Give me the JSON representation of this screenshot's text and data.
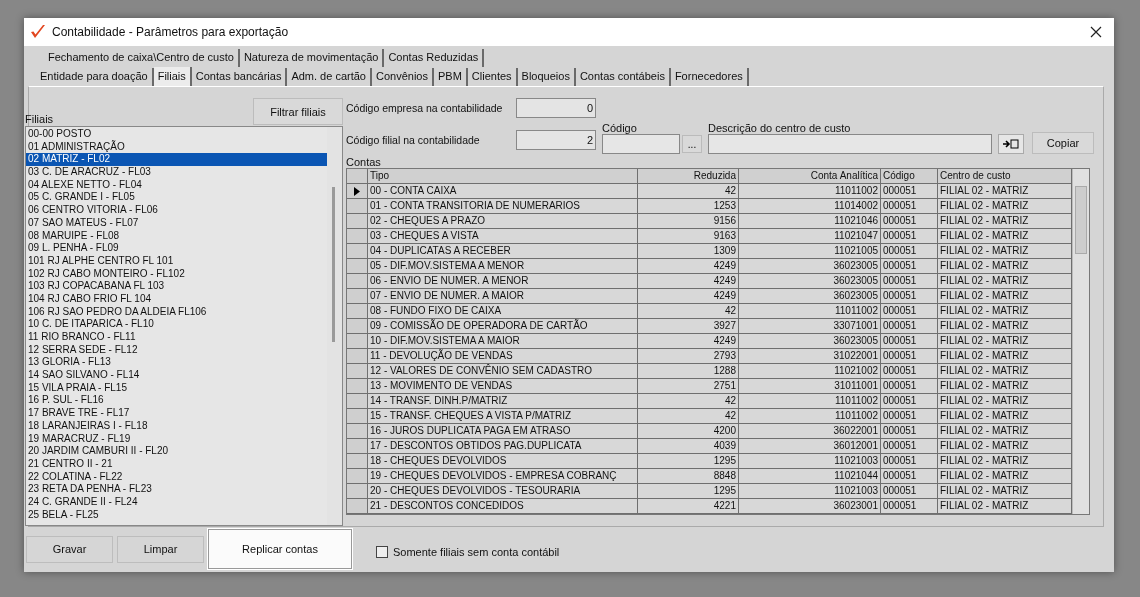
{
  "window": {
    "title": "Contabilidade - Parâmetros para exportação"
  },
  "tabs_row_1": [
    {
      "label": "Fechamento de caixa\\Centro de custo",
      "selected": false
    },
    {
      "label": "Natureza de movimentação",
      "selected": false
    },
    {
      "label": "Contas Reduzidas",
      "selected": false
    }
  ],
  "tabs_row_2": [
    {
      "label": "Entidade para doação",
      "selected": false
    },
    {
      "label": "Filiais",
      "selected": true
    },
    {
      "label": "Contas bancárias",
      "selected": false
    },
    {
      "label": "Adm. de cartão",
      "selected": false
    },
    {
      "label": "Convênios",
      "selected": false
    },
    {
      "label": "PBM",
      "selected": false
    },
    {
      "label": "Clientes",
      "selected": false
    },
    {
      "label": "Bloqueios",
      "selected": false
    },
    {
      "label": "Contas contábeis",
      "selected": false
    },
    {
      "label": "Fornecedores",
      "selected": false
    }
  ],
  "filiais": {
    "label": "Filiais",
    "filter_button": "Filtrar filiais",
    "items": [
      {
        "label": "00-00 POSTO",
        "selected": false
      },
      {
        "label": "01 ADMINISTRAÇÃO",
        "selected": false
      },
      {
        "label": "02 MATRIZ - FL02",
        "selected": true
      },
      {
        "label": "03 C. DE ARACRUZ - FL03",
        "selected": false
      },
      {
        "label": "04 ALEXE NETTO - FL04",
        "selected": false
      },
      {
        "label": "05 C. GRANDE I - FL05",
        "selected": false
      },
      {
        "label": "06 CENTRO VITORIA - FL06",
        "selected": false
      },
      {
        "label": "07 SAO MATEUS - FL07",
        "selected": false
      },
      {
        "label": "08 MARUIPE - FL08",
        "selected": false
      },
      {
        "label": "09 L. PENHA - FL09",
        "selected": false
      },
      {
        "label": "101 RJ ALPHE CENTRO FL 101",
        "selected": false
      },
      {
        "label": "102 RJ CABO MONTEIRO - FL102",
        "selected": false
      },
      {
        "label": "103 RJ COPACABANA FL 103",
        "selected": false
      },
      {
        "label": "104 RJ CABO FRIO FL 104",
        "selected": false
      },
      {
        "label": "106 RJ SAO PEDRO DA ALDEIA FL106",
        "selected": false
      },
      {
        "label": "10 C. DE ITAPARICA - FL10",
        "selected": false
      },
      {
        "label": "11 RIO BRANCO - FL11",
        "selected": false
      },
      {
        "label": "12 SERRA SEDE - FL12",
        "selected": false
      },
      {
        "label": "13 GLORIA - FL13",
        "selected": false
      },
      {
        "label": "14 SAO SILVANO - FL14",
        "selected": false
      },
      {
        "label": "15 VILA PRAIA - FL15",
        "selected": false
      },
      {
        "label": "16 P. SUL - FL16",
        "selected": false
      },
      {
        "label": "17 BRAVE TRE - FL17",
        "selected": false
      },
      {
        "label": "18 LARANJEIRAS I - FL18",
        "selected": false
      },
      {
        "label": "19 MARACRUZ - FL19",
        "selected": false
      },
      {
        "label": "20 JARDIM CAMBURI II - FL20",
        "selected": false
      },
      {
        "label": "21 CENTRO II - 21",
        "selected": false
      },
      {
        "label": "22 COLATINA - FL22",
        "selected": false
      },
      {
        "label": "23 RETA DA PENHA - FL23",
        "selected": false
      },
      {
        "label": "24 C. GRANDE II - FL24",
        "selected": false
      },
      {
        "label": "25 BELA - FL25",
        "selected": false
      }
    ]
  },
  "empresa": {
    "label": "Código empresa na contabilidade",
    "value": "0"
  },
  "filial": {
    "label": "Código filial na contabilidade",
    "value": "2"
  },
  "codigo": {
    "label": "Código",
    "button": "..."
  },
  "descricao": {
    "label": "Descrição do centro de custo"
  },
  "copy_button": "Copiar",
  "contas": {
    "label": "Contas",
    "columns": [
      "Tipo",
      "Reduzida",
      "Conta Analítica",
      "Código",
      "Centro de custo"
    ],
    "rows": [
      {
        "current": true,
        "cells": [
          "00 - CONTA CAIXA",
          "42",
          "11011002",
          "000051",
          "FILIAL 02 - MATRIZ"
        ]
      },
      {
        "current": false,
        "cells": [
          "01 - CONTA TRANSITORIA DE NUMERARIOS",
          "1253",
          "11014002",
          "000051",
          "FILIAL 02 - MATRIZ"
        ]
      },
      {
        "current": false,
        "cells": [
          "02 - CHEQUES A PRAZO",
          "9156",
          "11021046",
          "000051",
          "FILIAL 02 - MATRIZ"
        ]
      },
      {
        "current": false,
        "cells": [
          "03 - CHEQUES A VISTA",
          "9163",
          "11021047",
          "000051",
          "FILIAL 02 - MATRIZ"
        ]
      },
      {
        "current": false,
        "cells": [
          "04 - DUPLICATAS A RECEBER",
          "1309",
          "11021005",
          "000051",
          "FILIAL 02 - MATRIZ"
        ]
      },
      {
        "current": false,
        "cells": [
          "05 - DIF.MOV.SISTEMA A MENOR",
          "4249",
          "36023005",
          "000051",
          "FILIAL 02 - MATRIZ"
        ]
      },
      {
        "current": false,
        "cells": [
          "06 - ENVIO DE NUMER. A MENOR",
          "4249",
          "36023005",
          "000051",
          "FILIAL 02 - MATRIZ"
        ]
      },
      {
        "current": false,
        "cells": [
          "07 - ENVIO DE NUMER. A MAIOR",
          "4249",
          "36023005",
          "000051",
          "FILIAL 02 - MATRIZ"
        ]
      },
      {
        "current": false,
        "cells": [
          "08 - FUNDO FIXO DE CAIXA",
          "42",
          "11011002",
          "000051",
          "FILIAL 02 - MATRIZ"
        ]
      },
      {
        "current": false,
        "cells": [
          "09 - COMISSÃO DE OPERADORA DE CARTÃO",
          "3927",
          "33071001",
          "000051",
          "FILIAL 02 - MATRIZ"
        ]
      },
      {
        "current": false,
        "cells": [
          "10 - DIF.MOV.SISTEMA A MAIOR",
          "4249",
          "36023005",
          "000051",
          "FILIAL 02 - MATRIZ"
        ]
      },
      {
        "current": false,
        "cells": [
          "11 - DEVOLUÇÃO DE VENDAS",
          "2793",
          "31022001",
          "000051",
          "FILIAL 02 - MATRIZ"
        ]
      },
      {
        "current": false,
        "cells": [
          "12 - VALORES DE CONVÊNIO SEM CADASTRO",
          "1288",
          "11021002",
          "000051",
          "FILIAL 02 - MATRIZ"
        ]
      },
      {
        "current": false,
        "cells": [
          "13 - MOVIMENTO DE VENDAS",
          "2751",
          "31011001",
          "000051",
          "FILIAL 02 - MATRIZ"
        ]
      },
      {
        "current": false,
        "cells": [
          "14 - TRANSF. DINH.P/MATRIZ",
          "42",
          "11011002",
          "000051",
          "FILIAL 02 - MATRIZ"
        ]
      },
      {
        "current": false,
        "cells": [
          "15 - TRANSF. CHEQUES A VISTA P/MATRIZ",
          "42",
          "11011002",
          "000051",
          "FILIAL 02 - MATRIZ"
        ]
      },
      {
        "current": false,
        "cells": [
          "16 - JUROS DUPLICATA PAGA EM ATRASO",
          "4200",
          "36022001",
          "000051",
          "FILIAL 02 - MATRIZ"
        ]
      },
      {
        "current": false,
        "cells": [
          "17 - DESCONTOS OBTIDOS PAG.DUPLICATA",
          "4039",
          "36012001",
          "000051",
          "FILIAL 02 - MATRIZ"
        ]
      },
      {
        "current": false,
        "cells": [
          "18 - CHEQUES DEVOLVIDOS",
          "1295",
          "11021003",
          "000051",
          "FILIAL 02 - MATRIZ"
        ]
      },
      {
        "current": false,
        "cells": [
          "19 - CHEQUES DEVOLVIDOS - EMPRESA COBRANÇ",
          "8848",
          "11021044",
          "000051",
          "FILIAL 02 - MATRIZ"
        ]
      },
      {
        "current": false,
        "cells": [
          "20 - CHEQUES DEVOLVIDOS - TESOURARIA",
          "1295",
          "11021003",
          "000051",
          "FILIAL 02 - MATRIZ"
        ]
      },
      {
        "current": false,
        "cells": [
          "21 - DESCONTOS CONCEDIDOS",
          "4221",
          "36023001",
          "000051",
          "FILIAL 02 - MATRIZ"
        ]
      }
    ]
  },
  "buttons": [
    {
      "label": "Gravar",
      "focused": false
    },
    {
      "label": "Limpar",
      "focused": false
    },
    {
      "label": "Replicar contas",
      "focused": true
    }
  ],
  "only_without_account": {
    "label": "Somente filiais sem conta contábil",
    "checked": false
  }
}
